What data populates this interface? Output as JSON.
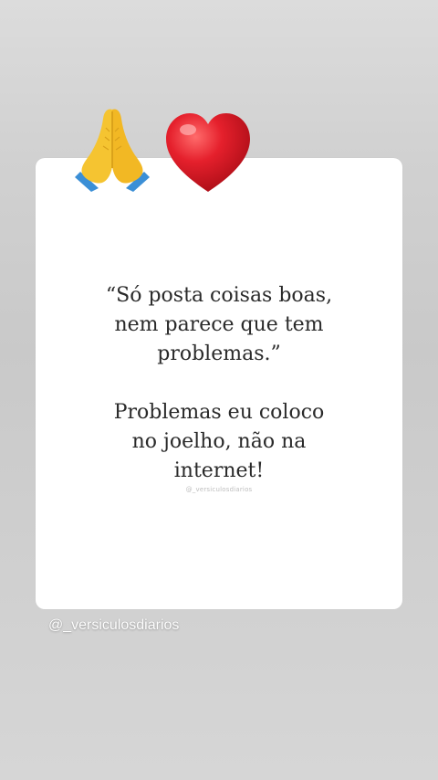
{
  "stickers": {
    "first": "praying-hands-icon",
    "second": "red-heart-icon"
  },
  "quote": {
    "lines_1": [
      "“Só posta coisas boas,",
      "nem parece que tem",
      "problemas.”"
    ],
    "lines_2": [
      "Problemas eu coloco",
      "no joelho, não na",
      "internet!"
    ]
  },
  "watermark": "@_versiculosdiarios",
  "handle": "@_versiculosdiarios",
  "colors": {
    "card": "#ffffff",
    "text": "#2a2a2a",
    "heart": "#e0202b",
    "hands": "#f5c431",
    "cuffs": "#3b8fd6"
  }
}
